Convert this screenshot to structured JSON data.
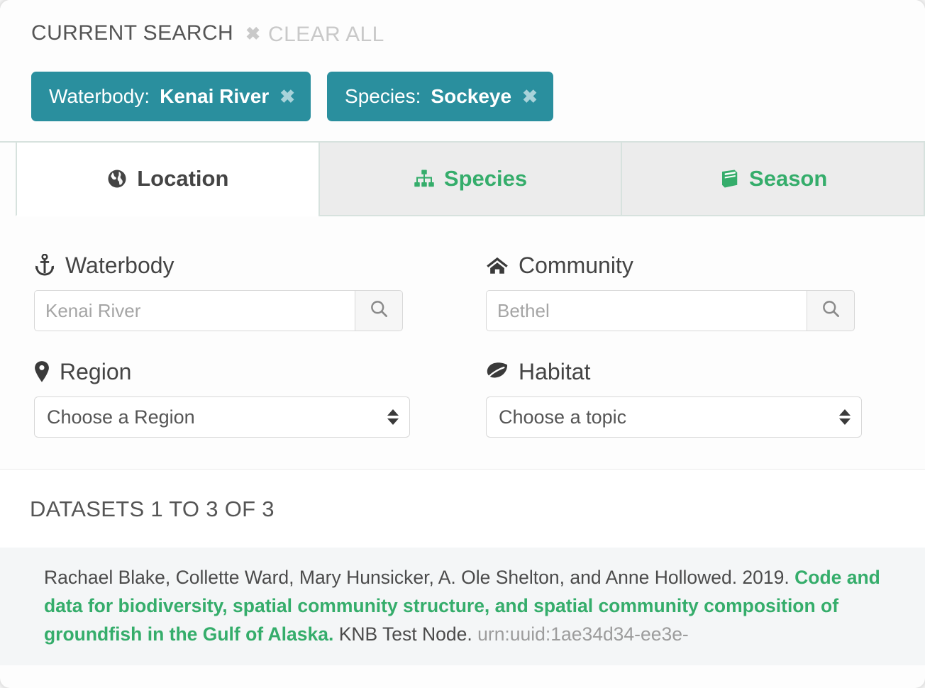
{
  "current_search": {
    "title": "CURRENT SEARCH",
    "clear_all_label": "CLEAR ALL",
    "clear_all_icon": "close-x-icon",
    "tags": [
      {
        "key": "Waterbody:",
        "value": "Kenai River",
        "remove_icon": "close-x-icon"
      },
      {
        "key": "Species:",
        "value": "Sockeye",
        "remove_icon": "close-x-icon"
      }
    ]
  },
  "tabs": [
    {
      "label": "Location",
      "icon": "globe-icon",
      "active": true
    },
    {
      "label": "Species",
      "icon": "sitemap-icon",
      "active": false
    },
    {
      "label": "Season",
      "icon": "book-icon",
      "active": false
    }
  ],
  "facets": {
    "waterbody": {
      "label": "Waterbody",
      "icon": "anchor-icon",
      "placeholder": "Kenai River",
      "value": "",
      "search_icon": "search-icon"
    },
    "community": {
      "label": "Community",
      "icon": "home-icon",
      "placeholder": "Bethel",
      "value": "",
      "search_icon": "search-icon"
    },
    "region": {
      "label": "Region",
      "icon": "map-pin-icon",
      "selected": "Choose a Region",
      "options": [
        "Choose a Region"
      ]
    },
    "habitat": {
      "label": "Habitat",
      "icon": "leaf-icon",
      "selected": "Choose a topic",
      "options": [
        "Choose a topic"
      ]
    }
  },
  "results": {
    "heading": "DATASETS 1 TO 3 OF 3",
    "items": [
      {
        "authors": "Rachael Blake, Collette Ward, Mary Hunsicker, A. Ole Shelton, and Anne Hollowed. 2019.",
        "title": "Code and data for biodiversity, spatial community structure, and spatial community composition of groundfish in the Gulf of Alaska.",
        "node": "KNB Test Node.",
        "identifier": "urn:uuid:1ae34d34-ee3e-"
      }
    ]
  },
  "colors": {
    "teal_tag": "#2a8f9e",
    "green_accent": "#35ad6b",
    "text_dark": "#444444",
    "text_muted": "#9c9c9c",
    "tab_inactive_bg": "#ececec",
    "result_bg": "#f4f6f7"
  }
}
